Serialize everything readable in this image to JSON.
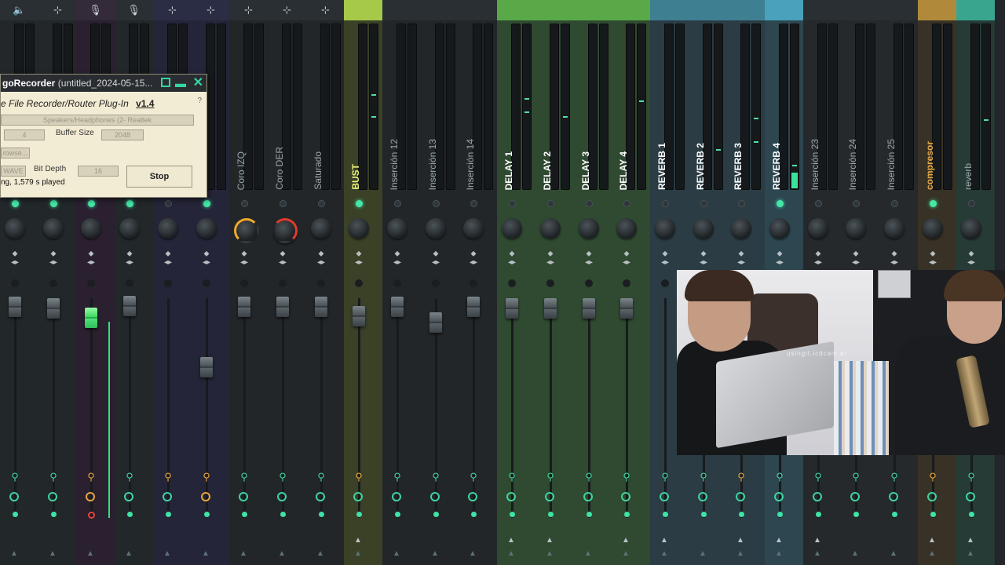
{
  "colors": {
    "accent_green": "#44e7a6",
    "fader_green": "#3fdc63",
    "fx_orange": "#e8a43a",
    "knob_yellow": "#f0a72a",
    "knob_red": "#e23a2d"
  },
  "top_icons": [
    "speaker-icon",
    "plug-icon",
    "mic-icon",
    "mic-icon",
    "plug-icon",
    "plug-icon",
    "plug-icon",
    "plug-icon",
    "plug-icon"
  ],
  "channels": [
    {
      "name": "",
      "header": "#2a2f33",
      "bg": "#22272a"
    },
    {
      "name": "",
      "header": "#2a2f33",
      "bg": "#22272a"
    },
    {
      "name": "",
      "header": "#352a3a",
      "bg": "#2a2030"
    },
    {
      "name": "",
      "header": "#2a2f33",
      "bg": "#22272a"
    },
    {
      "name": "",
      "header": "#2b2d44",
      "bg": "#242538"
    },
    {
      "name": "",
      "header": "#2b2d44",
      "bg": "#242538"
    },
    {
      "name": "Coro IZQ",
      "header": "#2a2f33",
      "bg": "#222629"
    },
    {
      "name": "Coro DER",
      "header": "#2a2f33",
      "bg": "#222629"
    },
    {
      "name": "Saturado",
      "header": "#2a2f33",
      "bg": "#222629"
    },
    {
      "name": "BUST",
      "header": "#a6c94a",
      "bg": "#3a4127"
    },
    {
      "name": "Inserción 12",
      "header": "#2a2f33",
      "bg": "#222629"
    },
    {
      "name": "Inserción 13",
      "header": "#2a2f33",
      "bg": "#222629"
    },
    {
      "name": "Inserción 14",
      "header": "#2a2f33",
      "bg": "#222629"
    },
    {
      "name": "DELAY 1",
      "header": "#5aa948",
      "bg": "#2f4a30"
    },
    {
      "name": "DELAY 2",
      "header": "#5aa948",
      "bg": "#2f4a30"
    },
    {
      "name": "DELAY 3",
      "header": "#5aa948",
      "bg": "#2f4a30"
    },
    {
      "name": "DELAY 4",
      "header": "#5aa948",
      "bg": "#2f4a30"
    },
    {
      "name": "REVERB 1",
      "header": "#3f7f92",
      "bg": "#2b3c44"
    },
    {
      "name": "REVERB 2",
      "header": "#3f7f92",
      "bg": "#2b3c44"
    },
    {
      "name": "REVERB 3",
      "header": "#3f7f92",
      "bg": "#2b3c44"
    },
    {
      "name": "REVERB 4",
      "header": "#4aa1bb",
      "bg": "#2d4650"
    },
    {
      "name": "Inserción 23",
      "header": "#2a2f33",
      "bg": "#25292c"
    },
    {
      "name": "Inserción 24",
      "header": "#2a2f33",
      "bg": "#25292c"
    },
    {
      "name": "Inserción 25",
      "header": "#2a2f33",
      "bg": "#25292c"
    },
    {
      "name": "compresor",
      "header": "#b08a3a",
      "bg": "#383226"
    },
    {
      "name": "reverb",
      "header": "#3aa58f",
      "bg": "#263a36"
    }
  ],
  "recorder": {
    "title": "goRecorder",
    "file": "(untitled_2024-05-15...",
    "subtitle": "e File Recorder/Router Plug-In",
    "version": "v1.4",
    "help": "?",
    "device": "Speakers/Headphones (2- Realtek",
    "channels_value": "4",
    "buffer_size_label": "Buffer Size",
    "buffer_size_value": "2048",
    "browse_label": "rowse...",
    "format_value": "WAVE",
    "bit_depth_label": "Bit Depth",
    "bit_depth_value": "16",
    "stop_label": "Stop",
    "status": "ng, 1,579 s played"
  },
  "webcam": {
    "watermark": "usingit.icdcam.ar"
  }
}
